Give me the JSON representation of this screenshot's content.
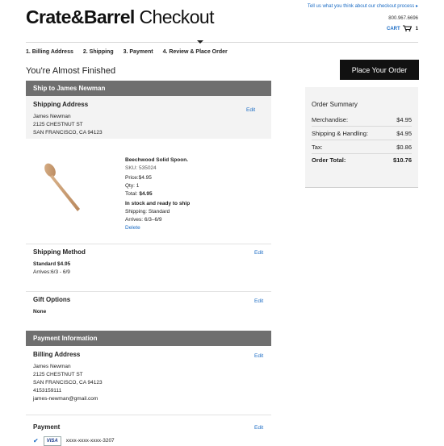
{
  "header": {
    "brand": "Crate&Barrel",
    "page_word": "Checkout",
    "feedback_link": "Tell us what you think about our checkout process",
    "phone": "800.967.6696",
    "cart_label": "CART",
    "cart_count": "1"
  },
  "steps": [
    "1. Billing Address",
    "2. Shipping",
    "3. Payment",
    "4. Review & Place Order"
  ],
  "page_title": "You're Almost Finished",
  "place_order_label": "Place Your Order",
  "ship_to": {
    "bar_label": "Ship to James Newman",
    "heading": "Shipping Address",
    "edit": "Edit",
    "name": "James Newman",
    "street": "2125 CHESTNUT ST",
    "city": "SAN FRANCISCO, CA 94123"
  },
  "item": {
    "name": "Beechwood Solid Spoon.",
    "sku": "SKU: 535024",
    "price": "Price:$4.95",
    "qty": "Qty: 1",
    "total_label": "Total:",
    "total_value": "$4.95",
    "stock": "In stock and ready to ship",
    "shipping": "Shipping: Standard",
    "arrives": "Arrives: 6/3–6/9",
    "delete": "Delete"
  },
  "shipping_method": {
    "heading": "Shipping Method",
    "edit": "Edit",
    "method": "Standard $4.95",
    "arrives": "Arrives:6/3 - 6/9"
  },
  "gift": {
    "heading": "Gift Options",
    "edit": "Edit",
    "value": "None"
  },
  "payment_info": {
    "bar_label": "Payment Information",
    "billing_heading": "Billing Address",
    "edit": "Edit",
    "name": "James Newman",
    "street": "2125 CHESTNUT ST",
    "city": "SAN FRANCISCO, CA 94123",
    "phone": "4153159111",
    "email": "james-newman@gmail.com",
    "payment_heading": "Payment",
    "payment_edit": "Edit",
    "card_brand": "VISA",
    "card_number": "xxxx-xxxx-xxxx-3207"
  },
  "summary": {
    "heading": "Order Summary",
    "rows": [
      {
        "label": "Merchandise:",
        "value": "$4.95"
      },
      {
        "label": "Shipping & Handling:",
        "value": "$4.95"
      },
      {
        "label": "Tax:",
        "value": "$0.86"
      }
    ],
    "total_label": "Order Total:",
    "total_value": "$10.76"
  },
  "colors": {
    "link": "#1a6bc4",
    "bar": "#6f6f6f",
    "button": "#111111"
  }
}
